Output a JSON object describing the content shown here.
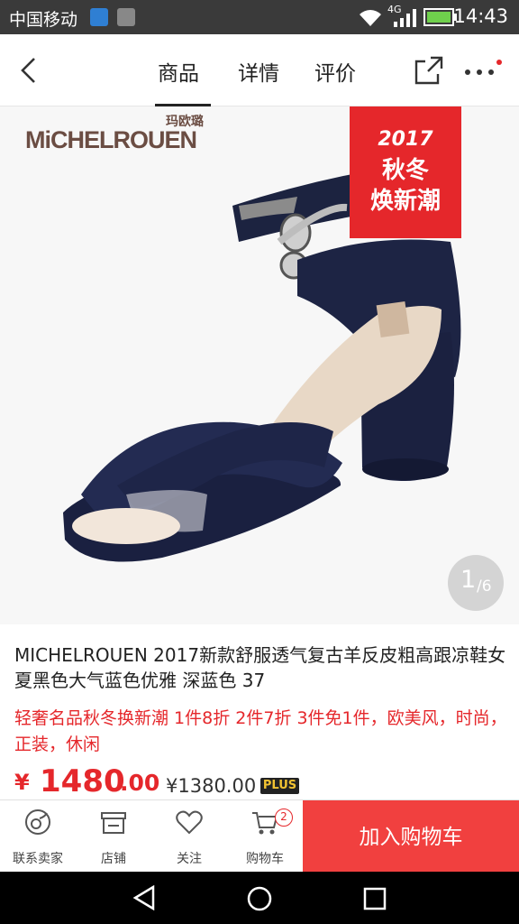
{
  "status_bar": {
    "carrier": "中国移动",
    "network": "4G",
    "time": "14:43"
  },
  "nav": {
    "back_icon": "chevron-left-icon",
    "tabs": [
      {
        "label": "商品",
        "active": true
      },
      {
        "label": "详情",
        "active": false
      },
      {
        "label": "评价",
        "active": false
      }
    ],
    "share_icon": "share-icon",
    "more_icon": "more-dots-icon"
  },
  "gallery": {
    "brand_logo": "MiCHELROUEN",
    "brand_logo_cn": "玛欧璐",
    "promo_tag": {
      "line1": "2017",
      "line2": "秋冬",
      "line3": "焕新潮"
    },
    "page_current": "1",
    "page_total": "/6"
  },
  "product": {
    "title": "MICHELROUEN 2017新款舒服透气复古羊反皮粗高跟凉鞋女夏黑色大气蓝色优雅 深蓝色 37",
    "promo": "轻奢名品秋冬换新潮 1件8折 2件7折 3件免1件，欧美风，时尚，正装，休闲",
    "price_symbol": "¥",
    "price_main": "1480",
    "price_cents": ".00",
    "plus_price": "¥1380.00",
    "plus_badge": "PLUS"
  },
  "action_bar": {
    "items": [
      {
        "label": "联系卖家",
        "icon": "customer-service-icon"
      },
      {
        "label": "店铺",
        "icon": "store-icon"
      },
      {
        "label": "关注",
        "icon": "heart-icon"
      },
      {
        "label": "购物车",
        "icon": "cart-icon",
        "badge": "2"
      }
    ],
    "add_to_cart": "加入购物车"
  },
  "colors": {
    "accent_red": "#e5272b",
    "button_red": "#f1403f"
  }
}
